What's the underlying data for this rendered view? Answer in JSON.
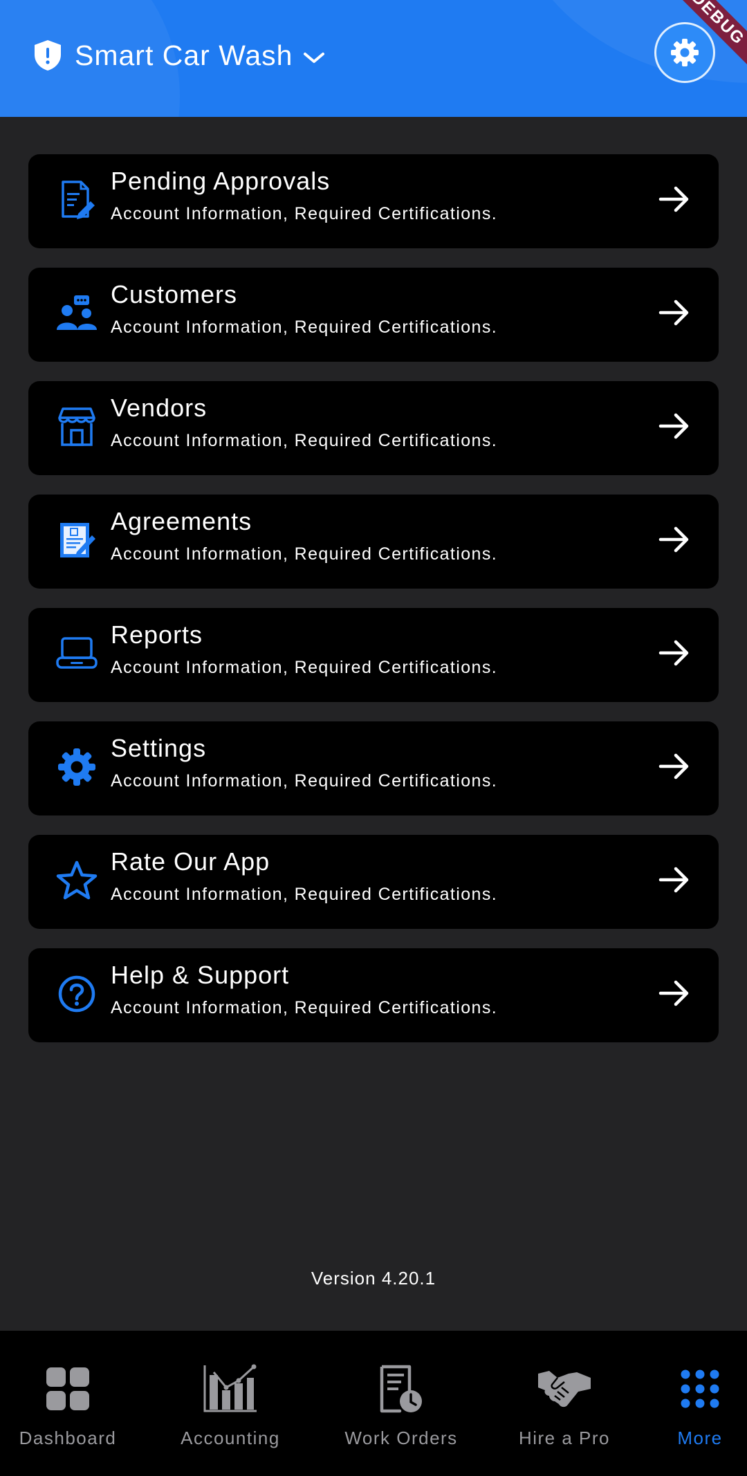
{
  "header": {
    "org_name": "Smart Car Wash",
    "debug_badge": "DEBUG",
    "accent": "#1f7bf2"
  },
  "menu": [
    {
      "icon": "document-sign-icon",
      "title": "Pending Approvals",
      "subtitle": "Account Information, Required Certifications."
    },
    {
      "icon": "customers-chat-icon",
      "title": "Customers",
      "subtitle": "Account Information, Required Certifications."
    },
    {
      "icon": "storefront-icon",
      "title": "Vendors",
      "subtitle": "Account Information, Required Certifications."
    },
    {
      "icon": "agreement-document-icon",
      "title": "Agreements",
      "subtitle": "Account Information, Required Certifications."
    },
    {
      "icon": "laptop-icon",
      "title": "Reports",
      "subtitle": "Account Information, Required Certifications."
    },
    {
      "icon": "gear-icon",
      "title": "Settings",
      "subtitle": "Account Information, Required Certifications."
    },
    {
      "icon": "star-icon",
      "title": "Rate Our App",
      "subtitle": "Account Information, Required Certifications."
    },
    {
      "icon": "help-circle-icon",
      "title": "Help & Support",
      "subtitle": "Account Information, Required Certifications."
    }
  ],
  "version_text": "Version 4.20.1",
  "bottom_nav": [
    {
      "icon": "dashboard-grid-icon",
      "label": "Dashboard",
      "active": false
    },
    {
      "icon": "accounting-chart-icon",
      "label": "Accounting",
      "active": false
    },
    {
      "icon": "work-order-clock-icon",
      "label": "Work Orders",
      "active": false
    },
    {
      "icon": "handshake-icon",
      "label": "Hire a Pro",
      "active": false
    },
    {
      "icon": "dots-grid-icon",
      "label": "More",
      "active": true
    }
  ]
}
